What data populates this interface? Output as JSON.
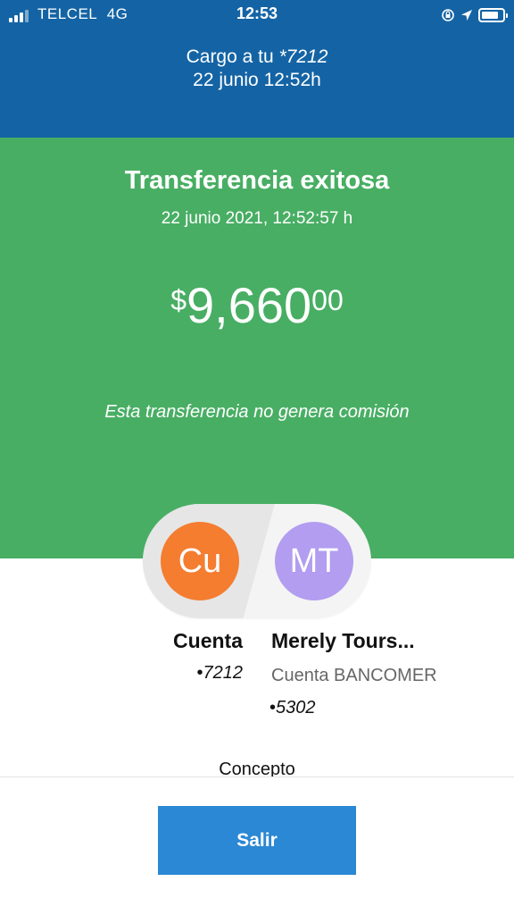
{
  "status_bar": {
    "carrier": "TELCEL",
    "network": "4G",
    "time": "12:53",
    "icons": [
      "signal-icon",
      "orientation-lock-icon",
      "location-arrow-icon",
      "battery-icon"
    ]
  },
  "header": {
    "charge_prefix": "Cargo a tu ",
    "charge_account": "*7212",
    "charge_date": "22 junio 12:52h"
  },
  "result": {
    "title": "Transferencia exitosa",
    "datetime": "22 junio 2021, 12:52:57 h",
    "amount_currency": "$",
    "amount_integer": "9,660",
    "amount_decimals": "00",
    "note": "Esta transferencia no genera comisión"
  },
  "participants": {
    "from": {
      "initials": "Cu",
      "name": "Cuenta",
      "account_bullet": "•",
      "account": "7212"
    },
    "to": {
      "initials": "MT",
      "name": "Merely Tours...",
      "bank": "Cuenta BANCOMER",
      "account_bullet": "•",
      "account": "5302"
    }
  },
  "details": {
    "concept_label": "Concepto"
  },
  "footer": {
    "exit_label": "Salir"
  },
  "colors": {
    "header_blue": "#1464a5",
    "success_green": "#48ae64",
    "avatar_from": "#f47d30",
    "avatar_to": "#b29df0",
    "button_blue": "#2a88d4"
  }
}
